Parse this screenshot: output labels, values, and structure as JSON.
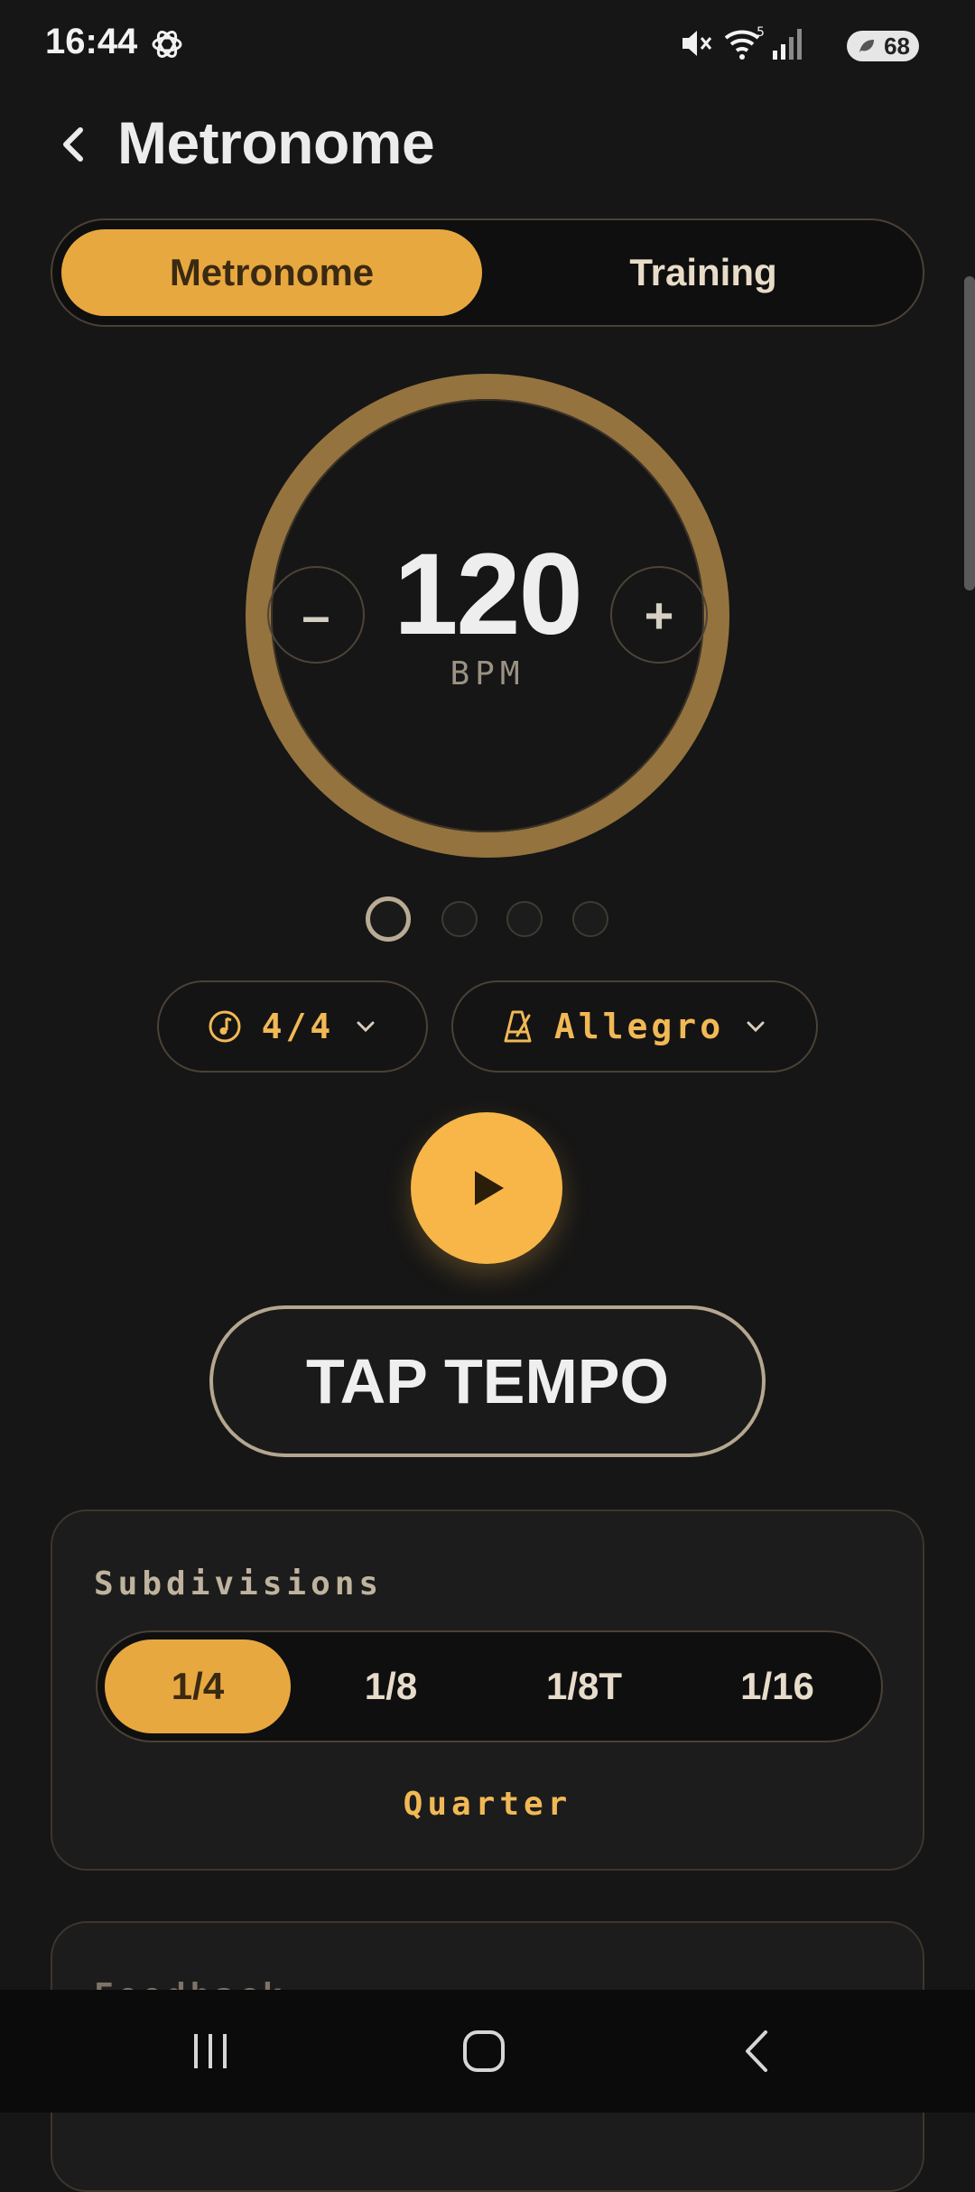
{
  "status_bar": {
    "time": "16:44",
    "battery": "68",
    "icons": [
      "chatgpt-icon",
      "mute-icon",
      "wifi-icon",
      "signal-icon",
      "battery-icon"
    ]
  },
  "header": {
    "title": "Metronome",
    "back_icon": "chevron-left-icon"
  },
  "mode_tabs": [
    {
      "label": "Metronome",
      "active": true
    },
    {
      "label": "Training",
      "active": false
    }
  ],
  "dial": {
    "bpm": "120",
    "unit": "BPM",
    "decrease_label": "–",
    "increase_label": "+"
  },
  "beats": {
    "count": 4,
    "current": 1
  },
  "controls": {
    "time_signature": "4/4",
    "tempo_marking": "Allegro",
    "time_signature_icon": "music-note-icon",
    "tempo_icon": "metronome-icon"
  },
  "play_icon": "play-icon",
  "tap_tempo_label": "TAP TEMPO",
  "subdivisions": {
    "title": "Subdivisions",
    "options": [
      "1/4",
      "1/8",
      "1/8T",
      "1/16"
    ],
    "selected": "1/4",
    "selected_name": "Quarter"
  },
  "next_card": {
    "title": "Feedback"
  },
  "colors": {
    "accent": "#e8a840",
    "accent_text": "#f1b955",
    "ring": "#94733f",
    "background": "#161616"
  }
}
